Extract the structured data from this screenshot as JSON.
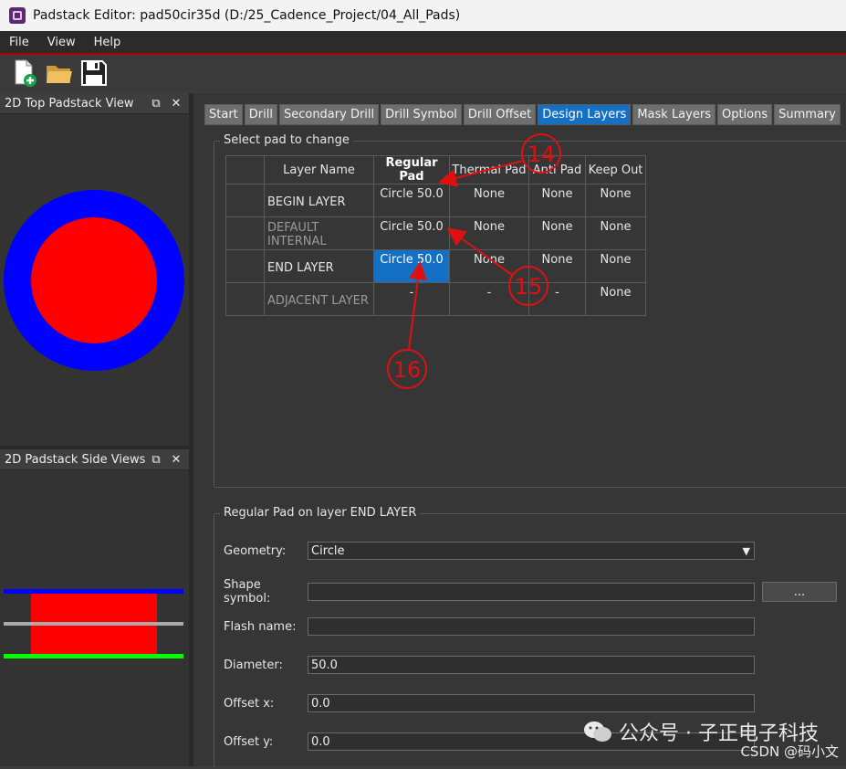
{
  "window": {
    "title": "Padstack Editor: pad50cir35d  (D:/25_Cadence_Project/04_All_Pads)"
  },
  "menu": [
    "File",
    "View",
    "Help"
  ],
  "toolbar": {
    "icons": [
      "new-padstack-icon",
      "open-folder-icon",
      "save-icon"
    ]
  },
  "top_view": {
    "title": "2D Top Padstack View",
    "outer_color": "#0000ff",
    "inner_color": "#ff0000"
  },
  "side_view": {
    "title": "2D Padstack Side Views",
    "colors": {
      "top": "#0000ff",
      "mid": "#aaaaaa",
      "bottom": "#00ff00",
      "pad": "#ff0000"
    }
  },
  "tabs": [
    {
      "label": "Start",
      "active": false
    },
    {
      "label": "Drill",
      "active": false
    },
    {
      "label": "Secondary Drill",
      "active": false
    },
    {
      "label": "Drill Symbol",
      "active": false
    },
    {
      "label": "Drill Offset",
      "active": false
    },
    {
      "label": "Design Layers",
      "active": true
    },
    {
      "label": "Mask Layers",
      "active": false
    },
    {
      "label": "Options",
      "active": false
    },
    {
      "label": "Summary",
      "active": false
    }
  ],
  "pad_table": {
    "group_title": "Select pad to change",
    "headers": [
      "Layer Name",
      "Regular Pad",
      "Thermal Pad",
      "Anti Pad",
      "Keep Out"
    ],
    "rows": [
      {
        "layer": "BEGIN LAYER",
        "regular": "Circle 50.0",
        "thermal": "None",
        "anti": "None",
        "keepout": "None"
      },
      {
        "layer": "DEFAULT INTERNAL",
        "regular": "Circle 50.0",
        "thermal": "None",
        "anti": "None",
        "keepout": "None"
      },
      {
        "layer": "END LAYER",
        "regular": "Circle 50.0",
        "thermal": "None",
        "anti": "None",
        "keepout": "None"
      },
      {
        "layer": "ADJACENT LAYER",
        "regular": "-",
        "thermal": "-",
        "anti": "-",
        "keepout": "None"
      }
    ]
  },
  "pad_form": {
    "group_title": "Regular Pad on layer END LAYER",
    "geometry_label": "Geometry:",
    "geometry_value": "Circle",
    "shape_symbol_label": "Shape symbol:",
    "shape_symbol_value": "",
    "browse_label": "...",
    "flash_name_label": "Flash name:",
    "flash_name_value": "",
    "diameter_label": "Diameter:",
    "diameter_value": "50.0",
    "offset_x_label": "Offset x:",
    "offset_x_value": "0.0",
    "offset_y_label": "Offset y:",
    "offset_y_value": "0.0"
  },
  "annotations": {
    "a14": "14",
    "a15": "15",
    "a16": "16",
    "color": "#e01010"
  },
  "watermark": {
    "text": "公众号 · 子正电子科技",
    "source": "CSDN @码小文"
  }
}
